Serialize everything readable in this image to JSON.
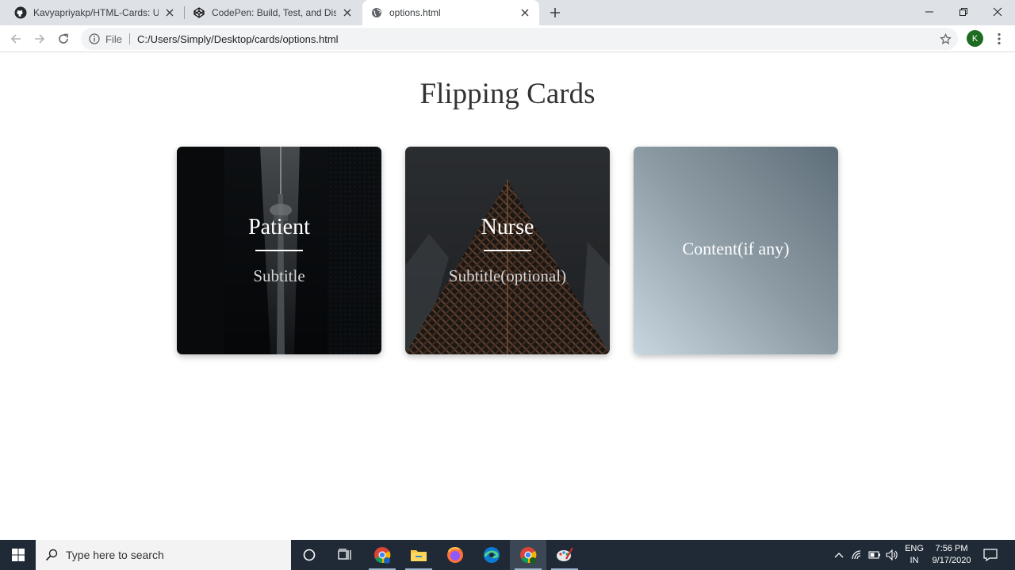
{
  "browser": {
    "tabs": [
      {
        "title": "Kavyapriyakp/HTML-Cards: Used",
        "icon": "github-icon"
      },
      {
        "title": "CodePen: Build, Test, and Discove",
        "icon": "codepen-icon"
      },
      {
        "title": "options.html",
        "icon": "globe-icon"
      }
    ],
    "address": {
      "scheme_label": "File",
      "url": "C:/Users/Simply/Desktop/cards/options.html"
    },
    "profile_initial": "K"
  },
  "page": {
    "title": "Flipping Cards",
    "cards": [
      {
        "heading": "Patient",
        "subtitle": "Subtitle"
      },
      {
        "heading": "Nurse",
        "subtitle": "Subtitle(optional)"
      },
      {
        "content": "Content(if any)"
      }
    ]
  },
  "taskbar": {
    "search_placeholder": "Type here to search",
    "language": "ENG",
    "region": "IN",
    "time": "7:56 PM",
    "date": "9/17/2020"
  },
  "colors": {
    "tabstrip": "#dee1e6",
    "taskbar": "#1f2a36",
    "profile": "#1e6b22"
  }
}
